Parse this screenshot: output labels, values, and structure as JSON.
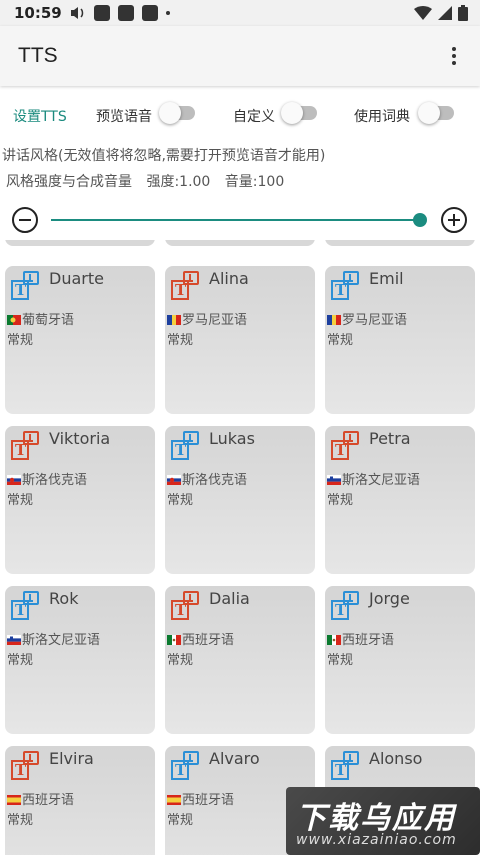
{
  "status_bar": {
    "time": "10:59"
  },
  "app_bar": {
    "title": "TTS"
  },
  "settings": {
    "tab_label": "设置TTS",
    "preview_label": "预览语音",
    "custom_label": "自定义",
    "dict_label": "使用词典"
  },
  "style_hint": "讲话风格(无效值将将忽略,需要打开预览语音才能用)",
  "style_line": {
    "label": "风格强度与合成音量",
    "strength": "强度:1.00",
    "volume": "音量:100"
  },
  "slider": {
    "value_fraction": 1.0
  },
  "voices": [
    {
      "name": "Duarte",
      "lang": "葡萄牙语",
      "style": "常规",
      "icon": "blue",
      "flag": "pt"
    },
    {
      "name": "Alina",
      "lang": "罗马尼亚语",
      "style": "常规",
      "icon": "red",
      "flag": "ro"
    },
    {
      "name": "Emil",
      "lang": "罗马尼亚语",
      "style": "常规",
      "icon": "blue",
      "flag": "ro"
    },
    {
      "name": "Viktoria",
      "lang": "斯洛伐克语",
      "style": "常规",
      "icon": "red",
      "flag": "sk"
    },
    {
      "name": "Lukas",
      "lang": "斯洛伐克语",
      "style": "常规",
      "icon": "blue",
      "flag": "sk"
    },
    {
      "name": "Petra",
      "lang": "斯洛文尼亚语",
      "style": "常规",
      "icon": "red",
      "flag": "si"
    },
    {
      "name": "Rok",
      "lang": "斯洛文尼亚语",
      "style": "常规",
      "icon": "blue",
      "flag": "si"
    },
    {
      "name": "Dalia",
      "lang": "西班牙语",
      "style": "常规",
      "icon": "red",
      "flag": "mx"
    },
    {
      "name": "Jorge",
      "lang": "西班牙语",
      "style": "常规",
      "icon": "blue",
      "flag": "mx"
    },
    {
      "name": "Elvira",
      "lang": "西班牙语",
      "style": "常规",
      "icon": "red",
      "flag": "es"
    },
    {
      "name": "Alvaro",
      "lang": "西班牙语",
      "style": "常规",
      "icon": "blue",
      "flag": "es"
    },
    {
      "name": "Alonso",
      "lang": "",
      "style": "",
      "icon": "blue",
      "flag": ""
    }
  ],
  "watermark": {
    "big": "下载乌应用",
    "small": "www.xiazainiao.com"
  },
  "colors": {
    "accent": "#1b8c80",
    "icon_blue": "#2b8fd6",
    "icon_red": "#d64a2b"
  }
}
